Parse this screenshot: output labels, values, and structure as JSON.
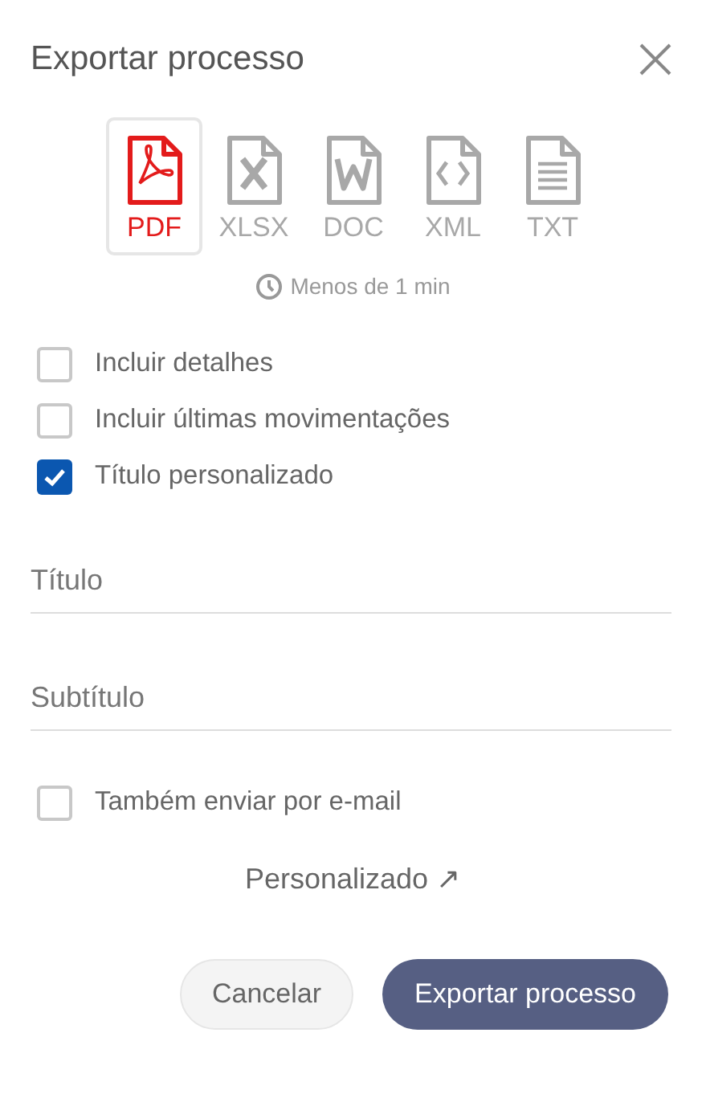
{
  "dialog": {
    "title": "Exportar processo"
  },
  "formats": [
    {
      "kind": "pdf",
      "label": "PDF",
      "selected": true
    },
    {
      "kind": "xlsx",
      "label": "XLSX",
      "selected": false
    },
    {
      "kind": "doc",
      "label": "DOC",
      "selected": false
    },
    {
      "kind": "xml",
      "label": "XML",
      "selected": false
    },
    {
      "kind": "txt",
      "label": "TXT",
      "selected": false
    }
  ],
  "estimate": "Menos de 1 min",
  "options": [
    {
      "label": "Incluir detalhes",
      "checked": false
    },
    {
      "label": "Incluir últimas movimentações",
      "checked": false
    },
    {
      "label": "Título personalizado",
      "checked": true
    }
  ],
  "fields": [
    {
      "placeholder": "Título"
    },
    {
      "placeholder": "Subtítulo"
    }
  ],
  "email_option": {
    "label": "Também enviar por e-mail",
    "checked": false
  },
  "link": "Personalizado ↗",
  "buttons": [
    {
      "kind": "secondary",
      "label": "Cancelar"
    },
    {
      "kind": "primary",
      "label": "Exportar processo"
    }
  ]
}
